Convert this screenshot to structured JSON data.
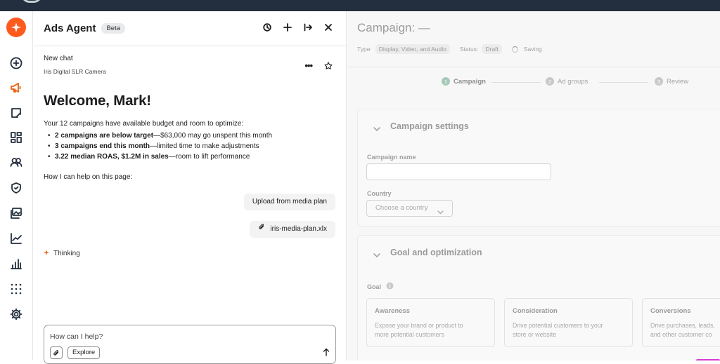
{
  "chat": {
    "title": "Ads Agent",
    "badge": "Beta",
    "header_icons": [
      "history-icon",
      "plus-icon",
      "expand-icon",
      "close-icon"
    ],
    "thread_title": "New chat",
    "product": "Iris Digital SLR Camera",
    "welcome": "Welcome, Mark!",
    "intro": "Your 12 campaigns have available budget and room to optimize:",
    "bullets": [
      {
        "bold": "2 campaigns are below target",
        "rest": "—$63,000 may go unspent this month"
      },
      {
        "bold": "3 campaigns end this month",
        "rest": "—limited time to make adjustments"
      },
      {
        "bold": "3.22 median ROAS, $1.2M in sales",
        "rest": "—room to lift performance"
      }
    ],
    "help_prompt": "How I can help on this page:",
    "user_message": "Upload from media plan",
    "attachment": "iris-media-plan.xlx",
    "status": "Thinking",
    "composer": {
      "placeholder": "How can I help?",
      "explore_label": "Explore"
    }
  },
  "sidebar": {
    "items": [
      "create-icon",
      "campaigns-icon",
      "edit-icon",
      "dashboard-icon",
      "audiences-icon",
      "shield-icon",
      "creative-icon",
      "trend-icon",
      "reports-icon",
      "apps-icon",
      "settings-icon"
    ]
  },
  "campaign": {
    "title": "Campaign: —",
    "type_label": "Type:",
    "type_value": "Display, Video, and Audio",
    "status_label": "Status:",
    "status_value": "Draft",
    "saving_label": "Saving",
    "steps": [
      {
        "num": "1",
        "label": "Campaign"
      },
      {
        "num": "2",
        "label": "Ad groups"
      },
      {
        "num": "3",
        "label": "Review"
      }
    ],
    "settings": {
      "title": "Campaign settings",
      "name_label": "Campaign name",
      "country_label": "Country",
      "country_placeholder": "Choose a country"
    },
    "goal": {
      "title": "Goal and optimization",
      "goal_label": "Goal",
      "options": [
        {
          "title": "Awareness",
          "line1": "Expose your brand or product to",
          "line2": "more potential customers"
        },
        {
          "title": "Consideration",
          "line1": "Drive potential customers to your",
          "line2": "store or website"
        },
        {
          "title": "Conversions",
          "line1": "Drive purchases, leads,",
          "line2": "and other customer co"
        }
      ]
    }
  },
  "colors": {
    "brand": "#fe5a1d",
    "active_nav": "#e6600f",
    "step_active": "#a5cbb8",
    "topbar": "#232f3e"
  }
}
